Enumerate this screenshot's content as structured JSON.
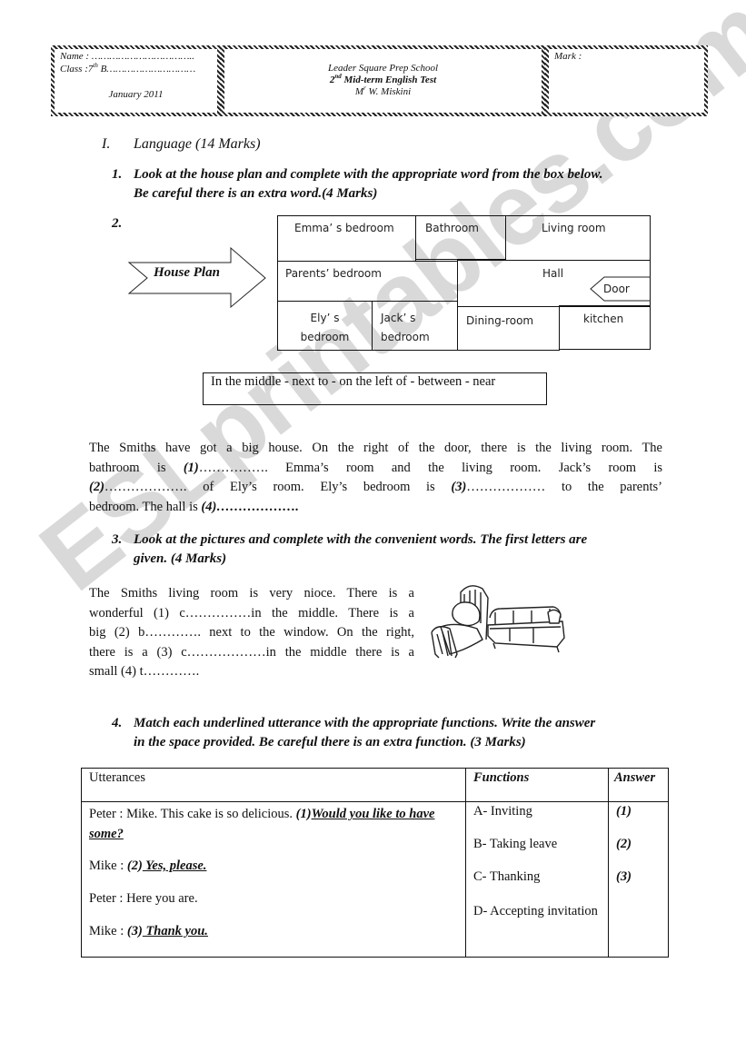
{
  "watermark": "ESLprintables.com",
  "header": {
    "name_line": "Name : ……………………………..",
    "class_prefix": "Class :7",
    "class_sup": "th",
    "class_suffix": " B…………………………",
    "date": "January 2011",
    "school": "Leader Square Prep School",
    "test_num": "2",
    "test_sup": "nd",
    "test_title": " Mid-term English Test",
    "teacher_prefix": "M",
    "teacher_sup": "r",
    "teacher_name": " W. Miskini",
    "mark_label": "Mark :"
  },
  "section": {
    "numeral": "I.",
    "title": "Language (14 Marks)"
  },
  "q1": {
    "number": "1.",
    "line1": "Look at the house plan and complete with the appropriate word from the box below.",
    "line2": "Be careful there is an extra word.(4 Marks)"
  },
  "q2": {
    "number": "2.",
    "arrow_label": "House Plan",
    "rooms": {
      "emma": "Emma’ s bedroom",
      "bathroom": "Bathroom",
      "living": "Living room",
      "parents": "Parents’ bedroom",
      "hall": "Hall",
      "door": "Door",
      "ely_1": "Ely’ s",
      "ely_2": "bedroom",
      "jack_1": "Jack’ s",
      "jack_2": "bedroom",
      "dining": "Dining-room",
      "kitchen": "kitchen"
    },
    "word_box": "In the middle - next to - on the left of -  between - near"
  },
  "passage1": {
    "l1": "The Smiths have got a big house. On the right of the door, there is the living room. The",
    "l2a": "bathroom is ",
    "l2b": "(1)",
    "l2c": "……………. Emma’s room and the living room.  Jack’s room is",
    "l3a": "(2)",
    "l3b": "………………. of Ely’s room. Ely’s bedroom is ",
    "l3c": "(3)",
    "l3d": "……………… to the parents’",
    "l4a": "bedroom. The hall is ",
    "l4b": "(4)",
    "l4c": "………………."
  },
  "q3": {
    "number": "3.",
    "line1": "Look at  the pictures and complete  with the convenient words. The first letters are",
    "line2": "given. (4 Marks)",
    "passage": [
      "The Smiths living room is very nioce. There is a",
      "wonderful (1) c……………in the middle. There is a",
      "big (2) b…………. next to the window. On the right,",
      "there is a (3) c………………in the middle there is a",
      "small  (4) t…………."
    ],
    "image_alt": "bed and sofa illustration"
  },
  "q4": {
    "number": "4.",
    "line1": "Match each underlined utterance with the appropriate functions. Write the answer",
    "line2": "in the space provided. Be careful there is an extra function. (3 Marks)",
    "table": {
      "headers": [
        "Utterances",
        "Functions",
        "Answer"
      ],
      "utterances": [
        {
          "speaker": "Peter : Mike. This cake is so delicious. ",
          "num": "(1)",
          "underlined": "Would you like to have some?"
        },
        {
          "speaker": "Mike : ",
          "num": "(2)",
          "underlined": " Yes, please."
        },
        {
          "speaker": "Peter : Here you are.",
          "num": "",
          "underlined": ""
        },
        {
          "speaker": "Mike : ",
          "num": "(3)",
          "underlined": " Thank you."
        }
      ],
      "functions": [
        "A- Inviting",
        "B- Taking leave",
        "C- Thanking",
        "D- Accepting invitation"
      ],
      "answers": [
        "(1)",
        "(2)",
        "(3)"
      ]
    }
  }
}
